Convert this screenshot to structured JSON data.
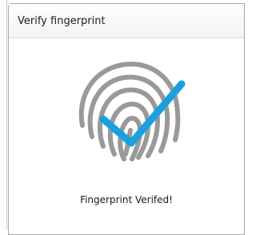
{
  "dialog": {
    "title": "Verify fingerprint",
    "status": "Fingerprint Verifed!"
  },
  "icons": {
    "fingerprint": "fingerprint-icon",
    "check": "checkmark-icon"
  },
  "colors": {
    "fingerprint": "#999999",
    "check": "#1aa0e0"
  }
}
